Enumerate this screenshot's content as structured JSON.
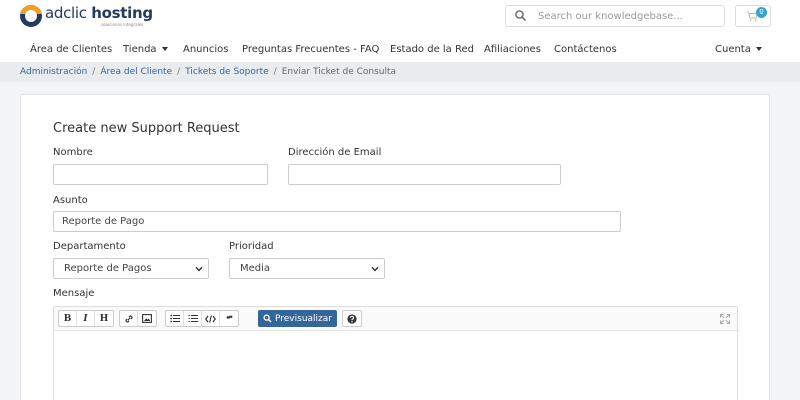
{
  "brand": {
    "name_regular": "adclic",
    "name_bold": "hosting",
    "tagline": "soluciones integrales"
  },
  "search": {
    "placeholder": "Search our knowledgebase..."
  },
  "cart": {
    "count": "0"
  },
  "nav": {
    "items": [
      {
        "label": "Área de Clientes"
      },
      {
        "label": "Tienda"
      },
      {
        "label": "Anuncios"
      },
      {
        "label": "Preguntas Frecuentes - FAQ"
      },
      {
        "label": "Estado de la Red"
      },
      {
        "label": "Afiliaciones"
      },
      {
        "label": "Contáctenos"
      }
    ],
    "account": "Cuenta"
  },
  "breadcrumb": {
    "items": [
      "Administración",
      "Área del Cliente",
      "Tickets de Soporte",
      "Enviar Ticket de Consulta"
    ]
  },
  "form": {
    "title": "Create new Support Request",
    "name_label": "Nombre",
    "name_value": "",
    "email_label": "Dirección de Email",
    "email_value": "",
    "subject_label": "Asunto",
    "subject_value": "Reporte de Pago",
    "department_label": "Departamento",
    "department_value": "Reporte de Pagos",
    "priority_label": "Prioridad",
    "priority_value": "Media",
    "message_label": "Mensaje"
  },
  "editor": {
    "bold": "B",
    "italic": "I",
    "heading": "H",
    "quote": "❝❞",
    "preview_label": "Previsualizar"
  },
  "colors": {
    "accent": "#336699",
    "brand_dark": "#243a5e",
    "brand_orange": "#f0a024",
    "badge": "#36a3d6"
  }
}
